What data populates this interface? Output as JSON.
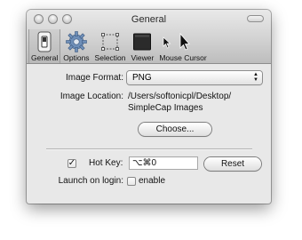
{
  "window": {
    "title": "General"
  },
  "toolbar": {
    "items": [
      {
        "label": "General",
        "icon": "general-switch-icon",
        "active": true
      },
      {
        "label": "Options",
        "icon": "gear-icon",
        "active": false
      },
      {
        "label": "Selection",
        "icon": "selection-icon",
        "active": false
      },
      {
        "label": "Viewer",
        "icon": "viewer-icon",
        "active": false
      },
      {
        "label": "Mouse Cursor",
        "icon": "mouse-cursor-icon",
        "active": false
      }
    ]
  },
  "general": {
    "image_format_label": "Image Format:",
    "image_format_value": "PNG",
    "image_location_label": "Image Location:",
    "image_location_line1": "/Users/softonicpl/Desktop/",
    "image_location_line2": "SimpleCap Images",
    "choose_button": "Choose...",
    "hotkey_label": "Hot Key:",
    "hotkey_enabled": true,
    "hotkey_value": "⌥⌘0",
    "reset_button": "Reset",
    "launch_label": "Launch on login:",
    "launch_checkbox_label": "enable",
    "launch_enabled": false
  },
  "colors": {
    "window_bg": "#e8e8e8",
    "titlebar_top": "#e9e9e9",
    "titlebar_bottom": "#bdbdbd"
  }
}
